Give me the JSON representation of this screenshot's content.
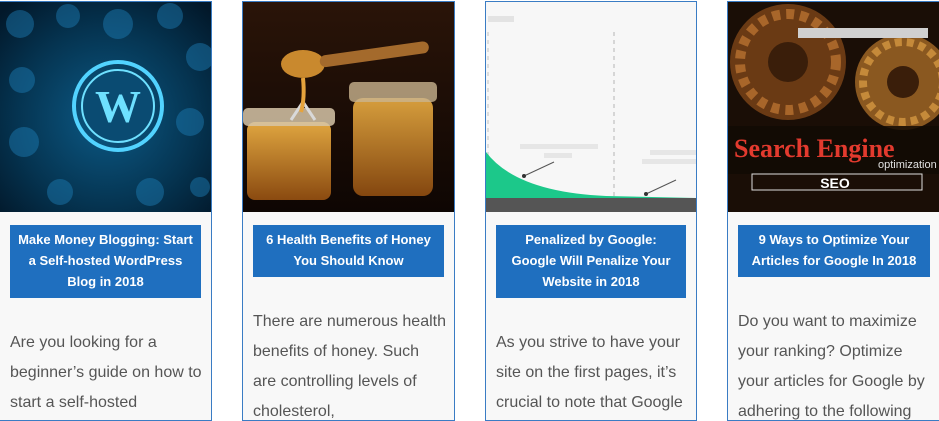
{
  "posts": [
    {
      "title": "Make Money Blogging: Start a Self-hosted WordPress Blog in 2018",
      "excerpt": "Are you looking for a beginner’s guide on how to start a self-hosted",
      "image": "wordpress-logo-image"
    },
    {
      "title": "6 Health Benefits of Honey You Should Know",
      "excerpt": "There are numerous health benefits of honey. Such are controlling levels of cholesterol,",
      "image": "honey-jars-image"
    },
    {
      "title": "Penalized by Google: Google Will Penalize Your Website in 2018",
      "excerpt": "As you strive to have your site on the first pages, it’s crucial to note that Google",
      "image": "traffic-drop-graph-image"
    },
    {
      "title": "9 Ways to Optimize Your Articles for Google In 2018",
      "excerpt": "Do you want to maximize your ranking? Optimize your articles for Google by adhering to the following",
      "image": "seo-gears-image",
      "image_text": {
        "line1": "Search Engine",
        "line2": "optimization",
        "line3": "SEO"
      }
    }
  ],
  "colors": {
    "title_bg": "#1f6fbf",
    "card_border": "#3a7cc4",
    "card_bg": "#f8f8f8",
    "excerpt_text": "#555555"
  }
}
